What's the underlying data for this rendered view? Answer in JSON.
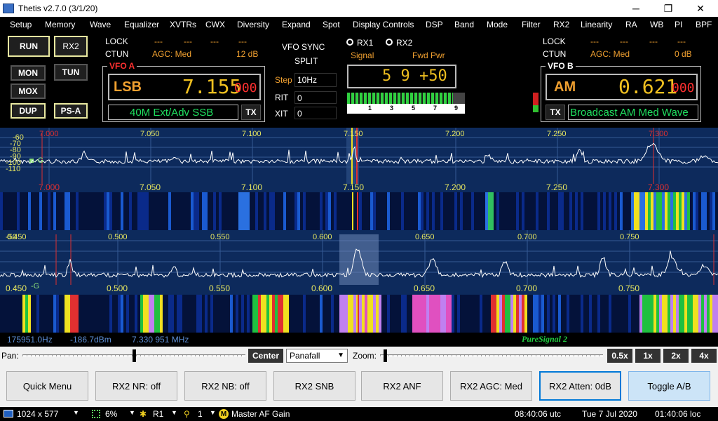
{
  "window": {
    "title": "Thetis v2.7.0 (3/1/20)",
    "min": "─",
    "max": "❐",
    "close": "✕"
  },
  "menu": [
    "Setup",
    "Memory",
    "Wave",
    "Equalizer",
    "XVTRs",
    "CWX",
    "Diversity",
    "Expand",
    "Spot",
    "Display Controls",
    "DSP",
    "Band",
    "Mode",
    "Filter",
    "RX2",
    "Linearity",
    "RA",
    "WB",
    "PI",
    "BPF"
  ],
  "buttons": {
    "run": "RUN",
    "rx2": "RX2",
    "mon": "MON",
    "tun": "TUN",
    "mox": "MOX",
    "dup": "DUP",
    "psa": "PS-A"
  },
  "vfoa": {
    "lock": "LOCK",
    "ctun": "CTUN",
    "dashes": "---",
    "agc": "AGC: Med",
    "gain": "12 dB",
    "tag": "VFO A",
    "mode": "LSB",
    "freq": "7.155",
    "sub": "000",
    "band": "40M Ext/Adv SSB",
    "tx": "TX"
  },
  "vfob": {
    "lock": "LOCK",
    "ctun": "CTUN",
    "dashes": "---",
    "agc": "AGC: Med",
    "gain": "0 dB",
    "tag": "VFO B",
    "mode": "AM",
    "freq": "0.621",
    "sub": "000",
    "band": "Broadcast AM Med Wave",
    "tx": "TX"
  },
  "center": {
    "sync": "VFO SYNC",
    "split": "SPLIT",
    "step_label": "Step",
    "step_value": "10Hz",
    "rit_label": "RIT",
    "rit_value": "0",
    "xit_label": "XIT",
    "xit_value": "0",
    "rx1": "RX1",
    "rx2": "RX2",
    "signal": "Signal",
    "fwdpwr": "Fwd Pwr",
    "meter": "5 9 +50",
    "scale": [
      "1",
      "3",
      "5",
      "7",
      "9"
    ],
    "meter_fill": 0.9
  },
  "rx1_panel": {
    "ylabels": [
      "-60",
      "-70",
      "-80",
      "-90",
      "-100",
      "-110"
    ],
    "marker_g": "-G",
    "ticks_top": [
      "7.000",
      "7.050",
      "7.100",
      "7.150",
      "7.200",
      "7.250",
      "7.300"
    ],
    "ticks_bottom": [
      "7.000",
      "7.050",
      "7.100",
      "7.150",
      "7.200",
      "7.250",
      "7.300"
    ]
  },
  "rx2_panel": {
    "ylabel_top": "-50",
    "marker_g": "-G",
    "ticks_top": [
      "0.450",
      "0.500",
      "0.550",
      "0.600",
      "0.650",
      "0.700",
      "0.750"
    ],
    "ticks_bottom": [
      "0.450",
      "0.500",
      "0.550",
      "0.600",
      "0.650",
      "0.700",
      "0.750"
    ]
  },
  "statusline": {
    "offset": "175951.0Hz",
    "power": "-186.7dBm",
    "freq": "7.330 951 MHz",
    "puresignal": "PureSignal 2"
  },
  "controls": {
    "pan": "Pan:",
    "center": "Center",
    "display_mode": "Panafall",
    "zoom": "Zoom:",
    "zooms": [
      "0.5x",
      "1x",
      "2x",
      "4x"
    ]
  },
  "bottom_buttons": [
    "Quick Menu",
    "RX2 NR: off",
    "RX2 NB: off",
    "RX2 SNB",
    "RX2 ANF",
    "RX2 AGC: Med",
    "RX2 Atten: 0dB",
    "Toggle A/B"
  ],
  "statusbar": {
    "resolution": "1024 x 577",
    "cpu": "6%",
    "rx": "R1",
    "antenna": "1",
    "master": "Master AF Gain",
    "utc": "08:40:06 utc",
    "date": "Tue 7 Jul 2020",
    "local": "01:40:06 loc"
  },
  "colors": {
    "panel_bg": "#0d2a5c",
    "trace": "#ffffff",
    "tick_yellow": "#e8e860",
    "tick_red": "#e03030",
    "accent": "#f0a030"
  }
}
